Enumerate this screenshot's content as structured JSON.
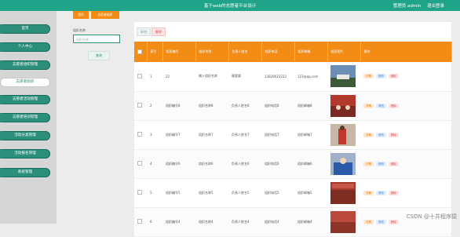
{
  "header": {
    "title": "基于web的志愿者平台设计",
    "welcome": "管理员 admin",
    "logout": "退出登录"
  },
  "sidebar": {
    "items": [
      {
        "label": "首页"
      },
      {
        "label": "个人中心"
      },
      {
        "label": "志愿者组织管理"
      },
      {
        "label": "志愿者组织"
      },
      {
        "label": "志愿者活动管理"
      },
      {
        "label": "志愿者培训管理"
      },
      {
        "label": "活动分类管理"
      },
      {
        "label": "活动报名管理"
      },
      {
        "label": "系统管理"
      }
    ]
  },
  "tabs": {
    "home": "首页",
    "current": "志愿者组织"
  },
  "search": {
    "label": "组织名称",
    "placeholder": "组织名称",
    "button": "查询"
  },
  "toolbar": {
    "add": "新增",
    "delete": "删除"
  },
  "table": {
    "headers": [
      "",
      "索引",
      "组织编号",
      "组织名称",
      "负责人姓名",
      "组织电话",
      "组织邮箱",
      "组织图片",
      "操作"
    ],
    "rows": [
      {
        "index": "1",
        "code": "22",
        "name": "输入组织名称",
        "leader": "赖婆婆",
        "phone": "13829022222",
        "email": "123@qq.com"
      },
      {
        "index": "2",
        "code": "组织编号8",
        "name": "组织名称8",
        "leader": "负责人姓名8",
        "phone": "组织电话8",
        "email": "组织邮箱8"
      },
      {
        "index": "3",
        "code": "组织编号7",
        "name": "组织名称7",
        "leader": "负责人姓名7",
        "phone": "组织电话7",
        "email": "组织邮箱7"
      },
      {
        "index": "4",
        "code": "组织编号6",
        "name": "组织名称6",
        "leader": "负责人姓名6",
        "phone": "组织电话6",
        "email": "组织邮箱6"
      },
      {
        "index": "5",
        "code": "组织编号5",
        "name": "组织名称5",
        "leader": "负责人姓名5",
        "phone": "组织电话5",
        "email": "组织邮箱5"
      },
      {
        "index": "6",
        "code": "组织编号4",
        "name": "组织名称4",
        "leader": "负责人姓名4",
        "phone": "组织电话4",
        "email": "组织邮箱4"
      }
    ],
    "ops": {
      "detail": "详情",
      "edit": "修改",
      "delete": "删除"
    }
  },
  "watermark": "CSDN @十井程序猿",
  "colors": {
    "accent": "#1fa389",
    "header_orange": "#f28c14"
  }
}
